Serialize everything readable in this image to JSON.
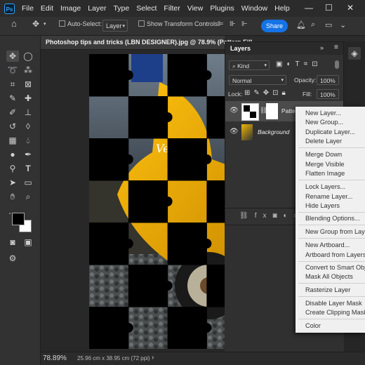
{
  "menubar": {
    "logo": "Ps",
    "items": [
      "File",
      "Edit",
      "Image",
      "Layer",
      "Type",
      "Select",
      "Filter",
      "View",
      "Plugins",
      "Window",
      "Help"
    ],
    "window_controls": [
      "—",
      "☐",
      "✕"
    ]
  },
  "options_bar": {
    "auto_select_label": "Auto-Select:",
    "layer_select_value": "Layer",
    "transform_label": "Show Transform Controls",
    "share_label": "Share"
  },
  "document": {
    "tab_title": "Photoshop tips and tricks (LBN DESIGNER).jpg @ 78.9% (Pattern Fill",
    "zoom": "78.89%",
    "dimensions": "25.96 cm x 38.95 cm (72 ppi)"
  },
  "layers_panel": {
    "tab_label": "Layers",
    "kind_label": "Kind",
    "blend_mode": "Normal",
    "opacity_label": "Opacity:",
    "opacity_value": "100%",
    "lock_label": "Lock:",
    "fill_label": "Fill:",
    "fill_value": "100%",
    "layers": [
      {
        "name": "Pattern"
      },
      {
        "name": "Background"
      }
    ]
  },
  "context_menu": {
    "groups": [
      [
        "New Layer...",
        "New Group...",
        "Duplicate Layer...",
        "Delete Layer"
      ],
      [
        "Merge Down",
        "Merge Visible",
        "Flatten Image"
      ],
      [
        "Lock Layers...",
        "Rename Layer...",
        "Hide Layers"
      ],
      [
        "Blending Options..."
      ],
      [
        "New Group from Layers"
      ],
      [
        "New Artboard...",
        "Artboard from Layers..."
      ],
      [
        "Convert to Smart Object",
        "Mask All Objects"
      ],
      [
        "Rasterize Layer"
      ],
      [
        "Disable Layer Mask",
        "Create Clipping Mask"
      ],
      [
        "Color"
      ]
    ]
  },
  "colors": {
    "accent": "#1473e6",
    "scooter_yellow": "#f2b705",
    "cursor_red": "#e03a2f"
  }
}
